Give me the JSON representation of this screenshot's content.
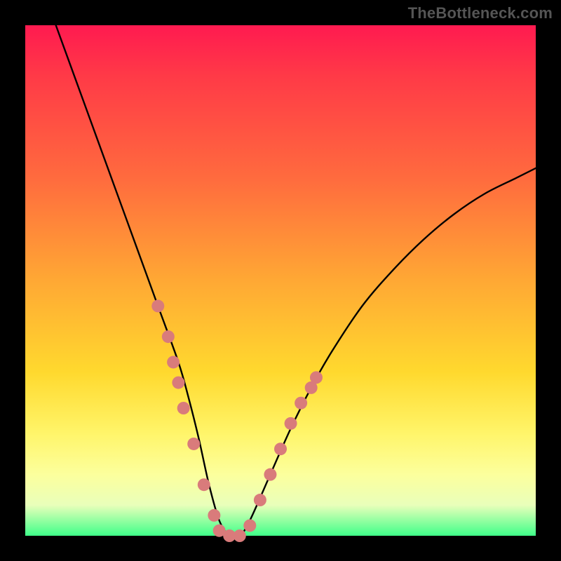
{
  "watermark": "TheBottleneck.com",
  "chart_data": {
    "type": "line",
    "title": "",
    "xlabel": "",
    "ylabel": "",
    "xlim": [
      0,
      100
    ],
    "ylim": [
      0,
      100
    ],
    "gradient_stops": [
      {
        "pct": 0,
        "color": "#ff1a50"
      },
      {
        "pct": 10,
        "color": "#ff3a47"
      },
      {
        "pct": 30,
        "color": "#ff6b3e"
      },
      {
        "pct": 50,
        "color": "#ffa834"
      },
      {
        "pct": 68,
        "color": "#ffd92e"
      },
      {
        "pct": 80,
        "color": "#fff56a"
      },
      {
        "pct": 88,
        "color": "#fcff9d"
      },
      {
        "pct": 94,
        "color": "#e9ffba"
      },
      {
        "pct": 100,
        "color": "#3fff89"
      }
    ],
    "series": [
      {
        "name": "bottleneck-curve",
        "color": "#000000",
        "x": [
          6,
          10,
          14,
          18,
          22,
          26,
          30,
          32,
          34,
          36,
          38,
          40,
          42,
          44,
          48,
          52,
          56,
          60,
          66,
          72,
          78,
          84,
          90,
          96,
          100
        ],
        "y": [
          100,
          89,
          78,
          67,
          56,
          45,
          34,
          27,
          19,
          10,
          3,
          0,
          0,
          3,
          12,
          21,
          29,
          36,
          45,
          52,
          58,
          63,
          67,
          70,
          72
        ]
      },
      {
        "name": "marker-dots",
        "color": "#d97b7b",
        "marker_radius": 9,
        "points": [
          {
            "x": 26,
            "y": 45
          },
          {
            "x": 28,
            "y": 39
          },
          {
            "x": 29,
            "y": 34
          },
          {
            "x": 30,
            "y": 30
          },
          {
            "x": 31,
            "y": 25
          },
          {
            "x": 33,
            "y": 18
          },
          {
            "x": 35,
            "y": 10
          },
          {
            "x": 37,
            "y": 4
          },
          {
            "x": 38,
            "y": 1
          },
          {
            "x": 40,
            "y": 0
          },
          {
            "x": 42,
            "y": 0
          },
          {
            "x": 44,
            "y": 2
          },
          {
            "x": 46,
            "y": 7
          },
          {
            "x": 48,
            "y": 12
          },
          {
            "x": 50,
            "y": 17
          },
          {
            "x": 52,
            "y": 22
          },
          {
            "x": 54,
            "y": 26
          },
          {
            "x": 56,
            "y": 29
          },
          {
            "x": 57,
            "y": 31
          }
        ]
      }
    ]
  }
}
